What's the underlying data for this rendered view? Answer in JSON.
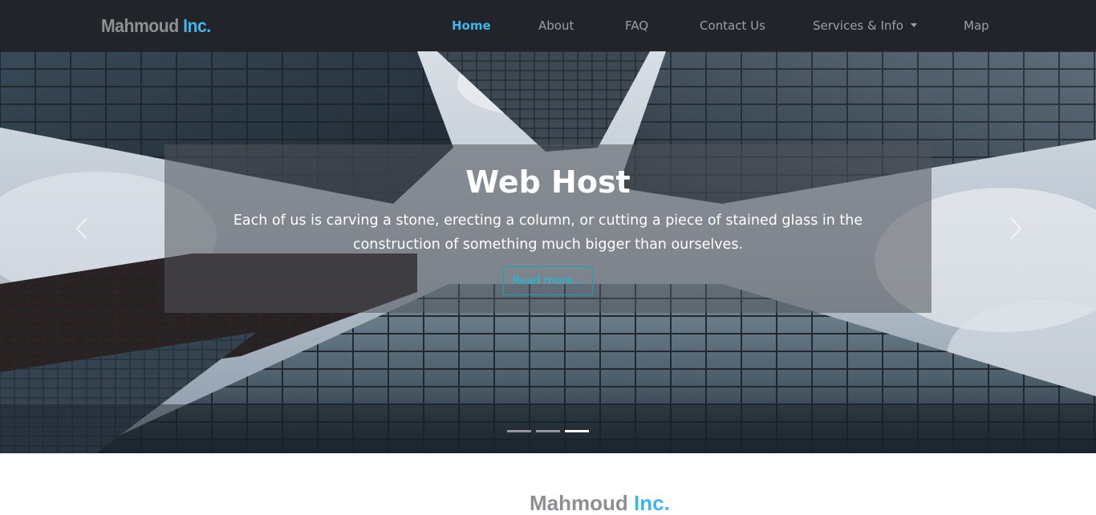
{
  "brand": {
    "part1": "Mahmoud",
    "part2": "Inc."
  },
  "nav": {
    "items": [
      {
        "label": "Home",
        "active": true
      },
      {
        "label": "About"
      },
      {
        "label": "FAQ"
      },
      {
        "label": "Contact Us"
      },
      {
        "label": "Services & Info",
        "dropdown": true
      },
      {
        "label": "Map"
      }
    ]
  },
  "carousel": {
    "title": "Web Host",
    "text": "Each of us is carving a stone, erecting a column, or cutting a piece of stained glass in the construction of something much bigger than ourselves.",
    "button": "Read more...",
    "slide_count": 3,
    "active_slide": 3
  },
  "section": {
    "title_part1": "Mahmoud",
    "title_part2": "Inc."
  },
  "colors": {
    "navbar_bg": "#212529",
    "accent": "#3fb6ec",
    "button_border": "#17a2b8"
  }
}
